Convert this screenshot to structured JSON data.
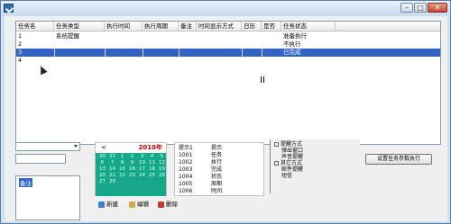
{
  "colors": {
    "selection": "#3163c5",
    "calendar_bg": "#16a88a",
    "calendar_year": "#c00000"
  },
  "window": {
    "icon": "checkmark-app-icon",
    "controls": {
      "minimize": "–",
      "maximize": "□",
      "close": "✕"
    }
  },
  "listview": {
    "columns": [
      "任务名",
      "任务类型",
      "执行时间",
      "执行周期",
      "备注",
      "时间显示方式",
      "日历",
      "是否",
      "任务状态"
    ],
    "rows": [
      {
        "id": "1",
        "type": "系统提醒",
        "status": "准备执行",
        "selected": false
      },
      {
        "id": "2",
        "type": "",
        "status": "不执行",
        "selected": false
      },
      {
        "id": "3",
        "type": "",
        "status": "已完成",
        "selected": true
      },
      {
        "id": "4",
        "type": "",
        "status": "",
        "selected": false
      }
    ]
  },
  "left_panel": {
    "combo_value": "",
    "input_value": "",
    "memo_text": "备注"
  },
  "calendar": {
    "nav_prev": "<",
    "year": "2010年",
    "cells": [
      "30",
      "31",
      "1",
      "2",
      "3",
      "4",
      "5",
      "6",
      "7",
      "8",
      "9",
      "10",
      "11",
      "12",
      "13",
      "14",
      "15",
      "16",
      "17",
      "18",
      "19",
      "20",
      "21",
      "22",
      "23",
      "24",
      "25",
      "26",
      "27",
      "28"
    ]
  },
  "info_list": {
    "rows": [
      {
        "c1": "提示1",
        "c2": "提示"
      },
      {
        "c1": "1001",
        "c2": "任务"
      },
      {
        "c1": "1002",
        "c2": "执行"
      },
      {
        "c1": "1003",
        "c2": "完成"
      },
      {
        "c1": "1004",
        "c2": "状态"
      },
      {
        "c1": "1005",
        "c2": "周期"
      },
      {
        "c1": "1006",
        "c2": "时间"
      }
    ]
  },
  "tree": {
    "nodes": [
      "提醒方式",
      "弹出窗口",
      "声音提醒",
      "其它方式",
      "邮件提醒",
      "短信"
    ]
  },
  "action_button": "设置任务参数执行",
  "toolbar": {
    "new_label": "新建",
    "edit_label": "编辑",
    "delete_label": "删除"
  }
}
